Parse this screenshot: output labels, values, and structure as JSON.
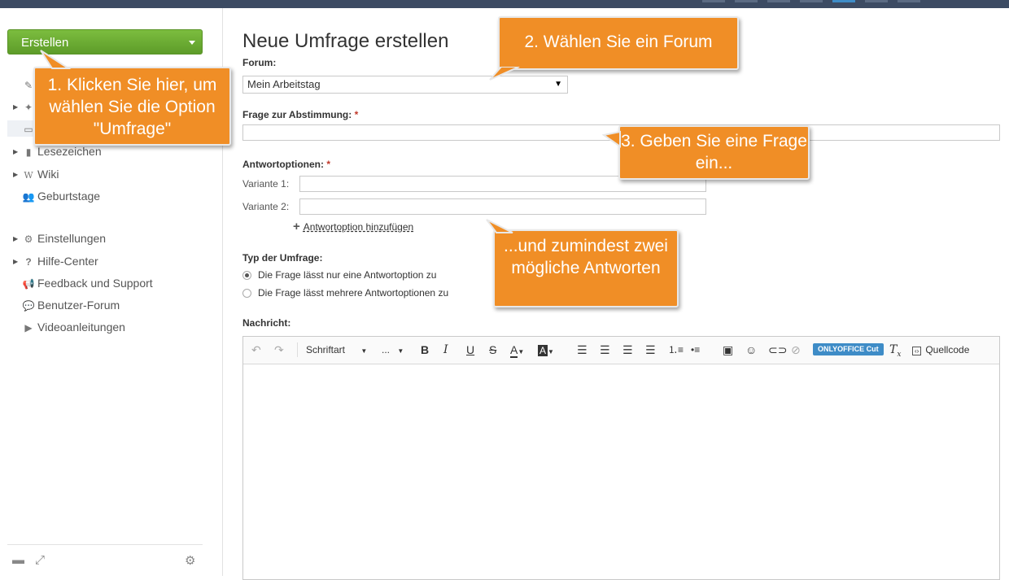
{
  "sidebar": {
    "create_label": "Erstellen",
    "items": [
      {
        "label": "",
        "icon": "edit-icon"
      },
      {
        "label": "",
        "icon": "pin-icon"
      },
      {
        "label": "",
        "icon": "comment-icon"
      },
      {
        "label": "Lesezeichen",
        "icon": "bookmark-icon"
      },
      {
        "label": "Wiki",
        "icon": "wiki-icon"
      },
      {
        "label": "Geburtstage",
        "icon": "users-icon"
      },
      {
        "label": "Einstellungen",
        "icon": "gear-icon"
      },
      {
        "label": "Hilfe-Center",
        "icon": "question-icon"
      },
      {
        "label": "Feedback und Support",
        "icon": "megaphone-icon"
      },
      {
        "label": "Benutzer-Forum",
        "icon": "chat-bubble-icon"
      },
      {
        "label": "Videoanleitungen",
        "icon": "play-icon"
      }
    ]
  },
  "form": {
    "title": "Neue Umfrage erstellen",
    "forum_label": "Forum:",
    "forum_value": "Mein Arbeitstag",
    "question_label": "Frage zur Abstimmung:",
    "required_mark": "*",
    "answers_label": "Antwortoptionen:",
    "variant1_label": "Variante 1:",
    "variant2_label": "Variante 2:",
    "add_option": "Antwortoption hinzufügen",
    "type_label": "Typ der Umfrage:",
    "type_single": "Die Frage lässt nur eine Antwortoption zu",
    "type_multiple": "Die Frage lässt mehrere Antwortoptionen zu",
    "message_label": "Nachricht:"
  },
  "editor": {
    "font_label": "Schriftart",
    "size_label": "...",
    "cut_label": "ONLYOFFICE Cut",
    "source_label": "Quellcode"
  },
  "callouts": {
    "c1": "1. Klicken Sie hier, um wählen Sie die Option \"Umfrage\"",
    "c2": "2. Wählen Sie ein Forum",
    "c3": "3. Geben Sie eine Frage ein...",
    "c4": "...und zumindest zwei mögliche Antworten"
  },
  "colors": {
    "accent_orange": "#f08e26",
    "create_green": "#6aaa33",
    "topbar": "#3c4b63"
  }
}
